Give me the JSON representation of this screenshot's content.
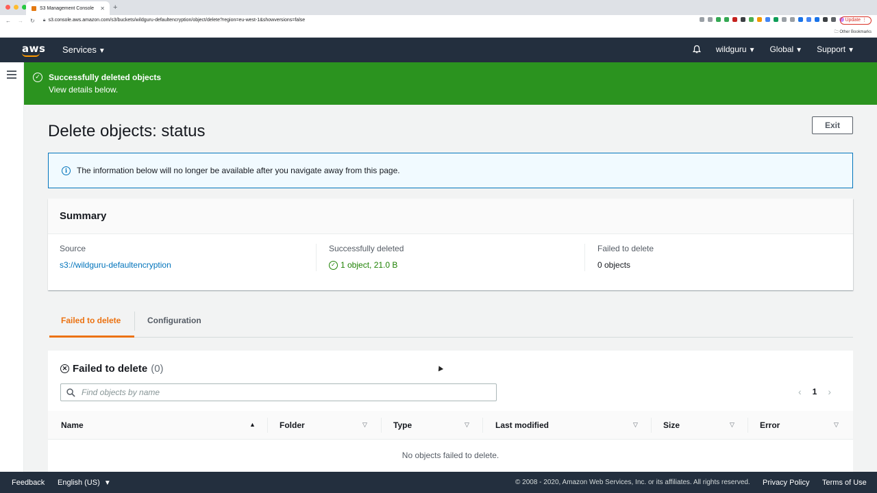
{
  "browser": {
    "tab_title": "S3 Management Console",
    "url": "s3.console.aws.amazon.com/s3/buckets/wildguru-defaultencryption/object/delete?region=eu-west-1&showversions=false",
    "update_label": "Update",
    "other_bookmarks": "Other Bookmarks"
  },
  "header": {
    "logo": "aws",
    "services": "Services",
    "user": "wildguru",
    "region": "Global",
    "support": "Support"
  },
  "flash": {
    "title": "Successfully deleted objects",
    "subtitle": "View details below."
  },
  "page": {
    "title": "Delete objects: status",
    "exit_label": "Exit",
    "info_message": "The information below will no longer be available after you navigate away from this page."
  },
  "summary": {
    "heading": "Summary",
    "source_label": "Source",
    "source_value": "s3://wildguru-defaultencryption",
    "deleted_label": "Successfully deleted",
    "deleted_value": "1 object, 21.0 B",
    "failed_label": "Failed to delete",
    "failed_value": "0 objects"
  },
  "tabs": [
    {
      "label": "Failed to delete",
      "active": true
    },
    {
      "label": "Configuration",
      "active": false
    }
  ],
  "failed_panel": {
    "heading": "Failed to delete",
    "count": "(0)",
    "search_placeholder": "Find objects by name",
    "page_number": "1",
    "columns": [
      "Name",
      "Folder",
      "Type",
      "Last modified",
      "Size",
      "Error"
    ],
    "empty_message": "No objects failed to delete."
  },
  "footer": {
    "feedback": "Feedback",
    "language": "English (US)",
    "copyright": "© 2008 - 2020, Amazon Web Services, Inc. or its affiliates. All rights reserved.",
    "privacy": "Privacy Policy",
    "terms": "Terms of Use"
  },
  "colors": {
    "header_bg": "#232f3e",
    "success_green": "#2b931f",
    "accent_orange": "#ec7211",
    "link_blue": "#0073bb"
  }
}
